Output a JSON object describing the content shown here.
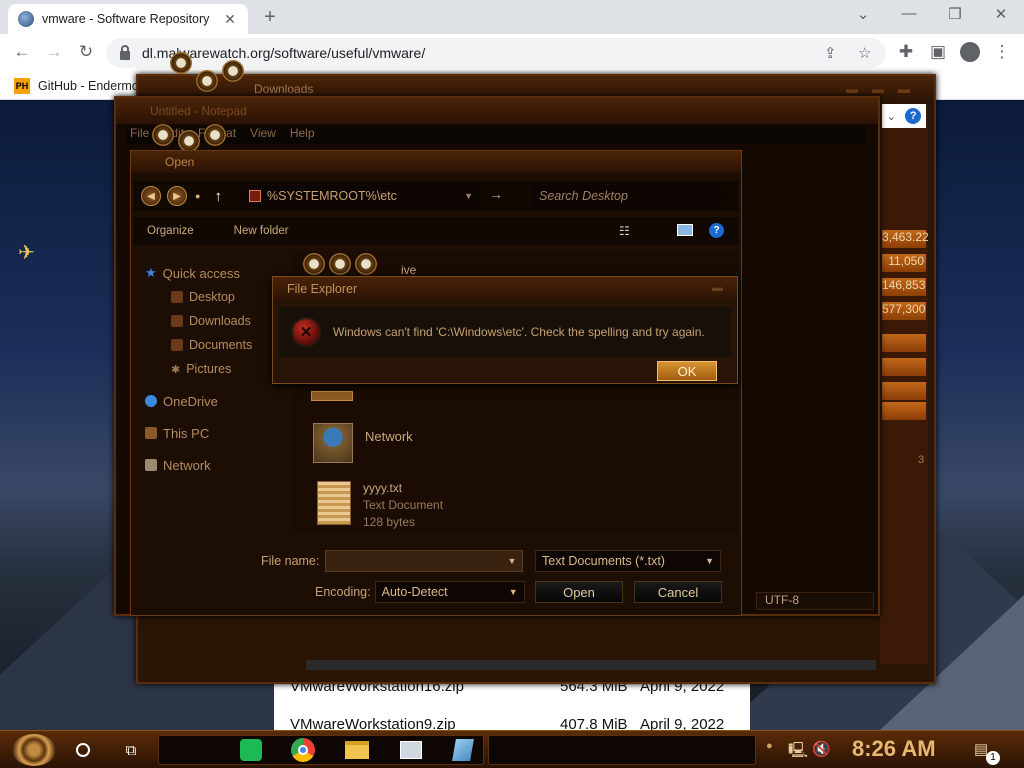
{
  "browser": {
    "tab_title": "vmware - Software Repository",
    "url": "dl.malwarewatch.org/software/useful/vmware/",
    "bookmark_icon_text": "PH",
    "bookmark_label": "GitHub - Endermo"
  },
  "webpage": {
    "rows": [
      {
        "name": "VMwareWorkstation16.zip",
        "size": "564.3 MiB",
        "date": "April 9, 2022"
      },
      {
        "name": "VMwareWorkstation9.zip",
        "size": "407.8 MiB",
        "date": "April 9, 2022"
      }
    ]
  },
  "explorer_window": {
    "title": "Downloads",
    "right_values": [
      "3,463.22",
      "11,050",
      "146,853",
      "577,300"
    ],
    "page_marker": "3",
    "encoding_status": "UTF-8"
  },
  "notepad": {
    "title": "Untitled - Notepad",
    "menu": [
      "File",
      "Edit",
      "Format",
      "View",
      "Help"
    ]
  },
  "open_dialog": {
    "title": "Open",
    "address": "%SYSTEMROOT%\\etc",
    "search_placeholder": "Search Desktop",
    "organize_label": "Organize",
    "new_folder_label": "New folder",
    "nav": {
      "quick_access": "Quick access",
      "desktop": "Desktop",
      "downloads": "Downloads",
      "documents": "Documents",
      "pictures": "Pictures",
      "onedrive": "OneDrive",
      "this_pc": "This PC",
      "network": "Network"
    },
    "files": {
      "partial_label": "ive",
      "network": "Network",
      "txt_name": "yyyy.txt",
      "txt_type": "Text Document",
      "txt_size": "128 bytes"
    },
    "file_name_label": "File name:",
    "file_name_value": "",
    "file_type": "Text Documents (*.txt)",
    "encoding_label": "Encoding:",
    "encoding_value": "Auto-Detect",
    "open_button": "Open",
    "cancel_button": "Cancel"
  },
  "error_dialog": {
    "title": "File Explorer",
    "message": "Windows can't find 'C:\\Windows\\etc'. Check the spelling and try again.",
    "ok_button": "OK"
  },
  "taskbar": {
    "clock": "8:26 AM",
    "notification_count": "1"
  },
  "colors": {
    "accent_copper": "#c4681c",
    "dialog_text": "#c8a070"
  }
}
